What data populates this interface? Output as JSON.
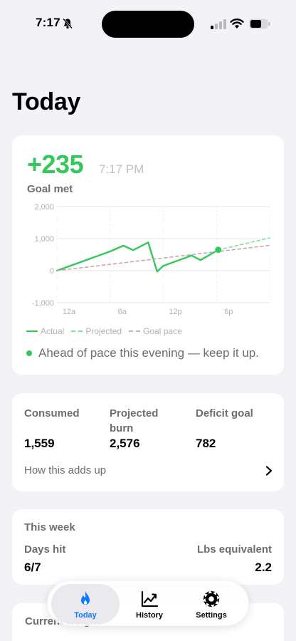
{
  "status_bar": {
    "time": "7:17"
  },
  "page": {
    "title": "Today"
  },
  "summary": {
    "value": "+235",
    "time": "7:17 PM",
    "status": "Goal met",
    "pace_message": "Ahead of pace this evening — keep it up."
  },
  "chart_data": {
    "type": "line",
    "x_tick_labels": [
      "12a",
      "6a",
      "12p",
      "6p"
    ],
    "y_tick_labels": [
      "2,000",
      "1,000",
      "0",
      "-1,000"
    ],
    "ylim": [
      -1000,
      2000
    ],
    "xlim": [
      0,
      24
    ],
    "grid": true,
    "legend": [
      "Actual",
      "Projected",
      "Goal pace"
    ],
    "legend_position": "bottom-left",
    "series": [
      {
        "name": "Actual",
        "style": "solid",
        "color": "#34c759",
        "points": [
          [
            0,
            0
          ],
          [
            6,
            600
          ],
          [
            7.5,
            780
          ],
          [
            8.6,
            640
          ],
          [
            10.3,
            880
          ],
          [
            11.3,
            -30
          ],
          [
            12,
            150
          ],
          [
            15.2,
            470
          ],
          [
            16.2,
            330
          ],
          [
            18.2,
            650
          ]
        ]
      },
      {
        "name": "Projected",
        "style": "dashed",
        "color": "#7ee29b",
        "points": [
          [
            18.2,
            650
          ],
          [
            24,
            1020
          ]
        ]
      },
      {
        "name": "Goal pace",
        "style": "dashed",
        "color": "#c8a7ae",
        "points": [
          [
            0,
            0
          ],
          [
            24,
            790
          ]
        ]
      }
    ],
    "current_point": [
      18.2,
      650
    ]
  },
  "stats": {
    "consumed": {
      "label": "Consumed",
      "value": "1,559"
    },
    "projected_burn": {
      "label_line1": "Projected",
      "label_line2": "burn",
      "value": "2,576"
    },
    "deficit_goal": {
      "label": "Deficit goal",
      "value": "782"
    },
    "link_label": "How this adds up"
  },
  "week": {
    "title": "This week",
    "days_hit_label": "Days hit",
    "days_hit_value": "6/7",
    "lbs_label": "Lbs equivalent",
    "lbs_value": "2.2"
  },
  "weight": {
    "label": "Current weight"
  },
  "tabs": [
    {
      "label": "Today",
      "icon": "flame-icon",
      "active": true
    },
    {
      "label": "History",
      "icon": "chart-icon",
      "active": false
    },
    {
      "label": "Settings",
      "icon": "gear-icon",
      "active": false
    }
  ],
  "colors": {
    "accent": "#34c759",
    "tab_active": "#0a7bff"
  }
}
